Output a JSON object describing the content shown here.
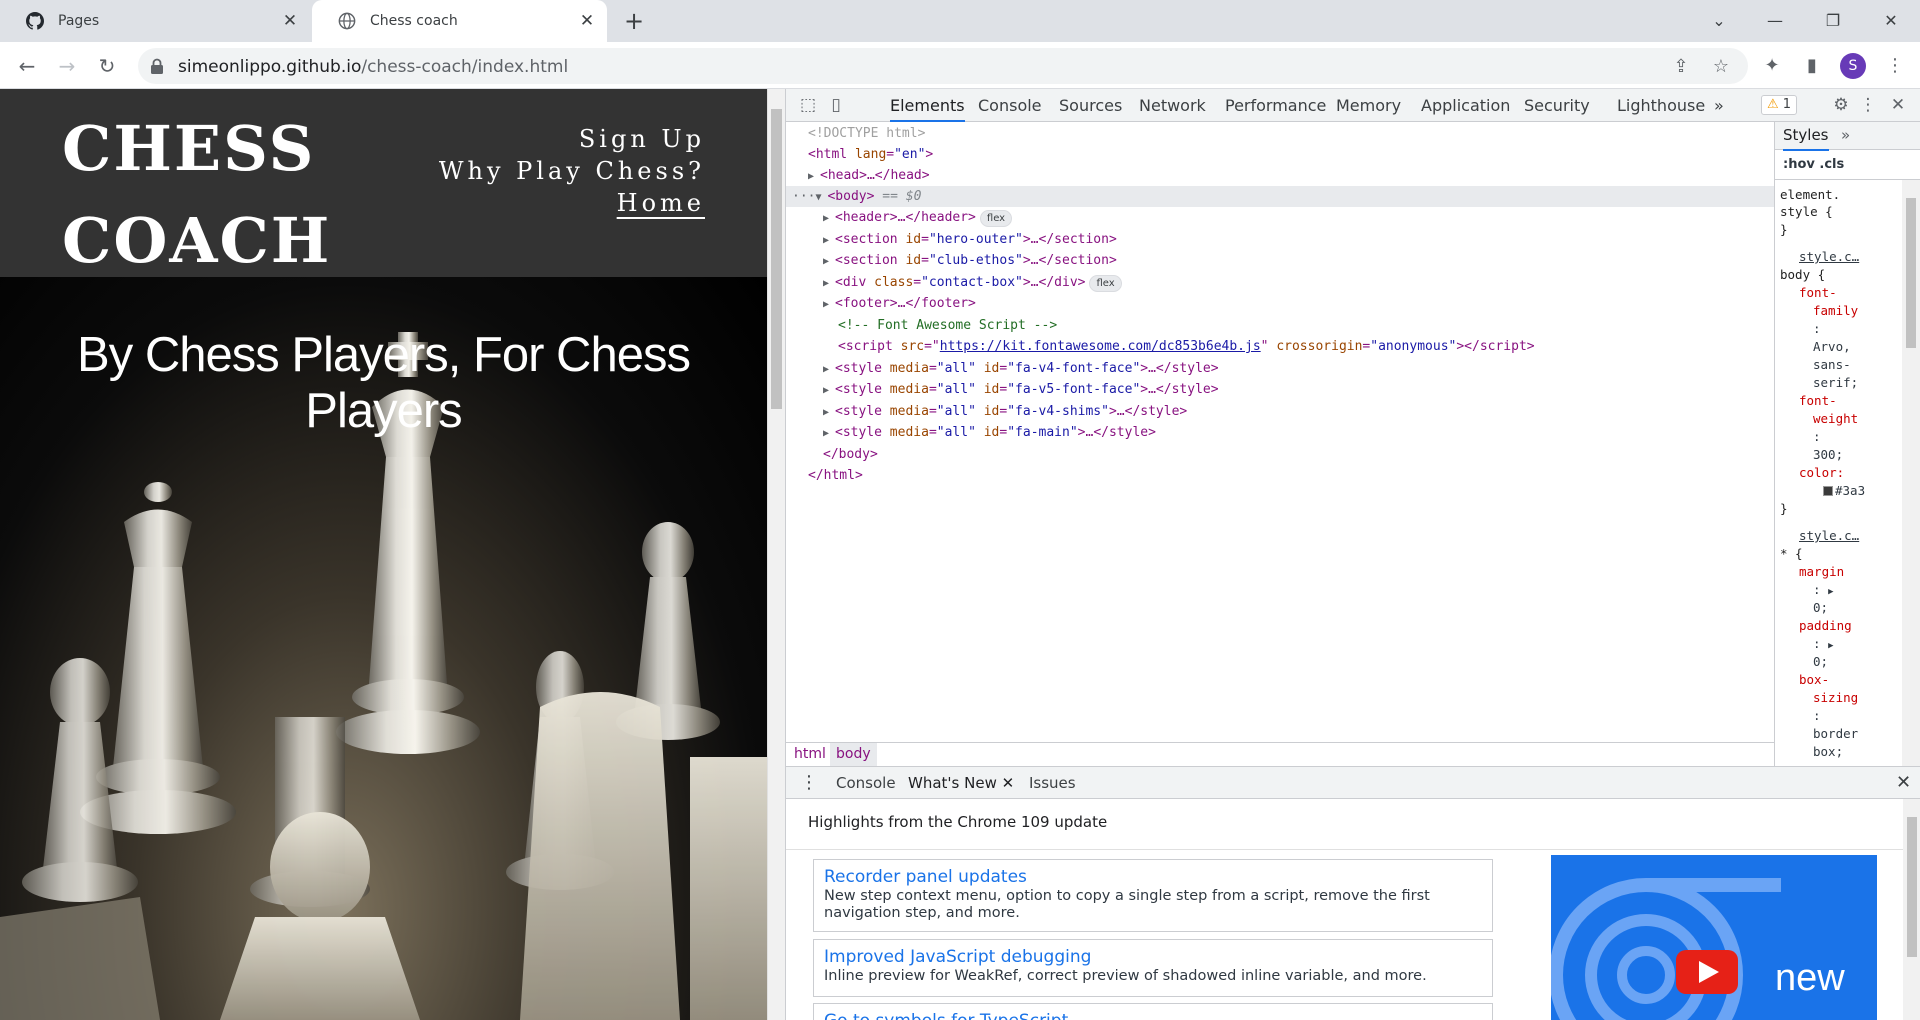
{
  "browser": {
    "tabs": [
      {
        "title": "Pages",
        "icon": "github-icon",
        "active": false
      },
      {
        "title": "Chess coach",
        "icon": "globe-icon",
        "active": true
      }
    ],
    "url_host": "simeonlippo.github.io",
    "url_path": "/chess-coach/index.html",
    "profile_initial": "S"
  },
  "site": {
    "logo": "CHESS COACH",
    "nav": [
      "Sign Up",
      "Why Play Chess?",
      "Home"
    ],
    "hero_title": "By Chess Players, For Chess Players"
  },
  "devtools": {
    "tabs": [
      "Elements",
      "Console",
      "Sources",
      "Network",
      "Performance",
      "Memory",
      "Application",
      "Security",
      "Lighthouse"
    ],
    "more_tabs": "»",
    "warning_count": "1",
    "dom": {
      "doctype": "<!DOCTYPE html>",
      "html_open": "<html",
      "html_lang_attr": "lang",
      "html_lang_val": "\"en\"",
      "head": "<head>…</head>",
      "body_open": "<body>",
      "body_eq": "== $0",
      "header": "<header>…</header>",
      "flex": "flex",
      "section1_attr": "id",
      "section1_val": "\"hero-outer\"",
      "section2_val": "\"club-ethos\"",
      "div_attr": "class",
      "div_val": "\"contact-box\"",
      "footer": "<footer>…</footer>",
      "comment": "<!-- Font Awesome Script -->",
      "script_src": "https://kit.fontawesome.com/dc853b6e4b.js",
      "script_cross_attr": "crossorigin",
      "script_cross_val": "\"anonymous\"",
      "style_media_attr": "media",
      "style_media_val": "\"all\"",
      "styles": [
        "\"fa-v4-font-face\"",
        "\"fa-v5-font-face\"",
        "\"fa-v4-shims\"",
        "\"fa-main\""
      ],
      "body_close": "</body>",
      "html_close": "</html>"
    },
    "breadcrumbs": [
      "html",
      "body"
    ],
    "styles": {
      "tab": "Styles",
      "more": "»",
      "filter_hov": ":hov",
      "filter_cls": ".cls",
      "element_style": "element.",
      "element_style2": "style {",
      "close_brace": "}",
      "source": "style.c…",
      "body_selector": "body {",
      "font_family_prop": "font-",
      "font_family_prop2": "family",
      "colon": ":",
      "font_family_val1": "Arvo,",
      "font_family_val2": "sans-",
      "font_family_val3": "serif;",
      "font_weight_prop": "font-",
      "font_weight_prop2": "weight",
      "font_weight_val": "300;",
      "color_prop": "color:",
      "color_val": "#3a3",
      "star_selector": "* {",
      "margin_prop": "margin",
      "margin_val": "0;",
      "padding_prop": "padding",
      "padding_val": "0;",
      "box_prop": "box-",
      "box_prop2": "sizing",
      "box_val1": "border",
      "box_val2": "box;"
    },
    "drawer": {
      "tabs": [
        "Console",
        "What's New",
        "Issues"
      ],
      "highlights": "Highlights from the Chrome 109 update",
      "cards": [
        {
          "title": "Recorder panel updates",
          "desc": "New step context menu, option to copy a single step from a script, remove the first navigation step, and more."
        },
        {
          "title": "Improved JavaScript debugging",
          "desc": "Inline preview for WeakRef, correct preview of shadowed inline variable, and more."
        },
        {
          "title": "Go to symbols for TypeScript",
          "desc": ""
        }
      ],
      "promo_text": "new"
    }
  }
}
